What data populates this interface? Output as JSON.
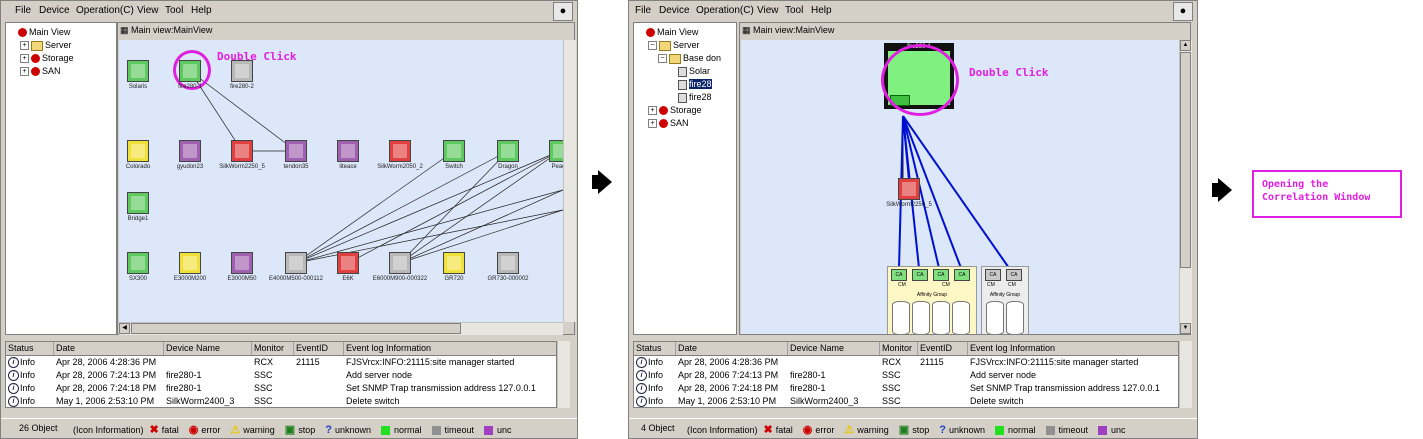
{
  "menu": [
    "File",
    "Device",
    "Operation(C)",
    "View",
    "Tool",
    "Help"
  ],
  "left": {
    "tree": {
      "root": "Main View",
      "items": [
        "Server",
        "Storage",
        "SAN"
      ]
    },
    "map_title": "Main view:MainView",
    "annotation": "Double Click",
    "devices": [
      {
        "label": "Solaris",
        "status": "green"
      },
      {
        "label": "fire280-1",
        "status": "green"
      },
      {
        "label": "fire280-2",
        "status": "gray"
      },
      {
        "label": "Colorado",
        "status": "yellow"
      },
      {
        "label": "gyudon23",
        "status": "purple"
      },
      {
        "label": "SilkWorm2250_5",
        "status": "red"
      },
      {
        "label": "tendon35",
        "status": "purple"
      },
      {
        "label": "liteace",
        "status": "purple"
      },
      {
        "label": "SilkWorm2050_2",
        "status": "red"
      },
      {
        "label": "Switch",
        "status": "green"
      },
      {
        "label": "Dragon",
        "status": "green"
      },
      {
        "label": "Peach",
        "status": "green"
      },
      {
        "label": "Bridge1",
        "status": "green"
      },
      {
        "label": "SX300",
        "status": "green"
      },
      {
        "label": "E3000M200",
        "status": "yellow"
      },
      {
        "label": "E3000M50",
        "status": "purple"
      },
      {
        "label": "E4000M500-000112",
        "status": "gray"
      },
      {
        "label": "E6K",
        "status": "red"
      },
      {
        "label": "E6000M900-000322",
        "status": "gray"
      },
      {
        "label": "GR720",
        "status": "yellow"
      },
      {
        "label": "GR730-000002",
        "status": "gray"
      }
    ],
    "events": [
      {
        "status": "Info",
        "date": "Apr 28, 2006 4:28:36 PM",
        "device": "",
        "monitor": "RCX",
        "eventid": "21115",
        "info": "FJSVrcx:INFO:21115:site manager started"
      },
      {
        "status": "Info",
        "date": "Apr 28, 2006 7:24:13 PM",
        "device": "fire280-1",
        "monitor": "SSC",
        "eventid": "",
        "info": "Add server node"
      },
      {
        "status": "Info",
        "date": "Apr 28, 2006 7:24:18 PM",
        "device": "fire280-1",
        "monitor": "SSC",
        "eventid": "",
        "info": "Set SNMP Trap transmission address 127.0.0.1"
      },
      {
        "status": "Info",
        "date": "May 1, 2006 2:53:10 PM",
        "device": "SilkWorm2400_3",
        "monitor": "SSC",
        "eventid": "",
        "info": "Delete switch"
      }
    ],
    "object_count": "26 Object"
  },
  "right": {
    "tree": {
      "root": "Main View",
      "server": "Server",
      "base": "Base don",
      "children": [
        "Solar",
        "fire28",
        "fire28"
      ],
      "items": [
        "Storage",
        "SAN"
      ]
    },
    "map_title": "Main view:MainView",
    "annotation": "Double Click",
    "server_label": "fire280-1",
    "switch_label": "SilkWorm2250_5",
    "ca_label": "CA",
    "cm_label": "CM",
    "group_label": "Affinity Group",
    "object_count": "4 Object"
  },
  "event_headers": [
    "Status",
    "Date",
    "Device Name",
    "Monitor",
    "EventID",
    "Event log Information"
  ],
  "legend": {
    "prefix": "(Icon Information)",
    "items": [
      {
        "label": "fatal",
        "icon": "x-icon",
        "color": "#cc0000"
      },
      {
        "label": "error",
        "icon": "error-icon",
        "color": "#cc0000"
      },
      {
        "label": "warning",
        "icon": "warning-icon",
        "color": "#e8c800"
      },
      {
        "label": "stop",
        "icon": "stop-icon",
        "color": "#208020"
      },
      {
        "label": "unknown",
        "icon": "question-icon",
        "color": "#2040c0"
      },
      {
        "label": "normal",
        "icon": "square",
        "color": "#20e020"
      },
      {
        "label": "timeout",
        "icon": "square",
        "color": "#909090"
      },
      {
        "label": "unc",
        "icon": "square",
        "color": "#a040c0"
      }
    ]
  },
  "callout": "Opening the Correlation Window"
}
